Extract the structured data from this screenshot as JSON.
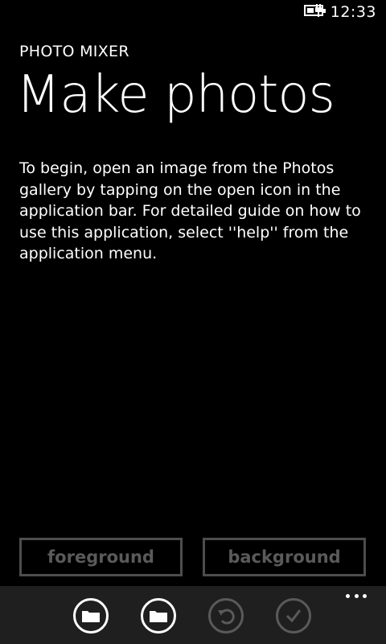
{
  "status_bar": {
    "time": "12:33",
    "battery_icon": "battery-charging-icon"
  },
  "header": {
    "app_title": "PHOTO MIXER",
    "page_title": "Make photos"
  },
  "main": {
    "instructions": "To begin, open an image from the Photos gallery by tapping on the open icon in the application bar.  For detailed guide on how to use this application, select ''help'' from the application menu."
  },
  "buttons": {
    "foreground_label": "foreground",
    "background_label": "background"
  },
  "app_bar": {
    "icons": [
      "open-folder-icon",
      "open-folder-icon",
      "undo-icon",
      "check-icon"
    ],
    "more_icon": "ellipsis-icon"
  },
  "colors": {
    "background": "#000000",
    "app_bar": "#1f1f1f",
    "text": "#ffffff",
    "disabled": "#5a5a5a"
  }
}
